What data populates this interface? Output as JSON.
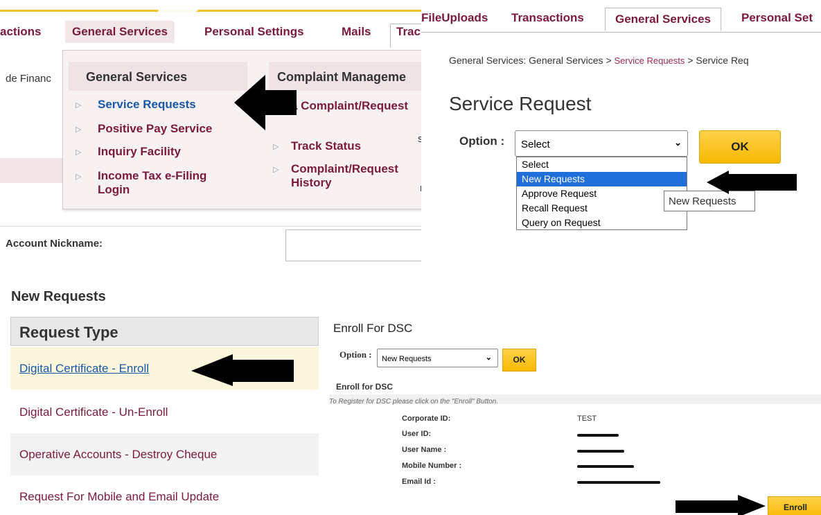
{
  "panel1": {
    "nav": {
      "transactions_partial": "actions",
      "general_services": "General Services",
      "personal_settings": "Personal Settings",
      "mails": "Mails",
      "trac_partial": "Trac"
    },
    "left_cut_text": "de Financ",
    "dropdown": {
      "col1_heading": "General Services",
      "col1_items": [
        "Service Requests",
        "Positive Pay Service",
        "Inquiry Facility",
        "Income Tax e-Filing Login"
      ],
      "col2_heading": "Complaint Manageme",
      "col2_items": [
        "a Complaint/Request",
        "Track Status",
        "Complaint/Request History"
      ]
    },
    "side_cut_1": "st",
    "side_cut_2": "r",
    "account_nickname_label": "Account Nickname:"
  },
  "panel2": {
    "tabs": [
      "FileUploads",
      "Transactions",
      "General Services",
      "Personal Set"
    ],
    "breadcrumb": {
      "part1": "General Services: General Services",
      "sep": ">",
      "link": "Service Requests",
      "part3": "Service Req"
    },
    "title": "Service Request",
    "option_label": "Option :",
    "select_value": "Select",
    "ok_label": "OK",
    "options": [
      "Select",
      "New Requests",
      "Approve Request",
      "Recall Request",
      "Query on Request"
    ],
    "highlighted_option": "New Requests",
    "tooltip": "New Requests"
  },
  "panel3": {
    "section_title": "New Requests",
    "table_header": "Request Type",
    "rows": [
      "Digital Certificate - Enroll",
      "Digital Certificate - Un-Enroll",
      "Operative Accounts - Destroy Cheque",
      "Request For Mobile and Email Update"
    ]
  },
  "panel4": {
    "heading": "Enroll For DSC",
    "option_label": "Option :",
    "select_value": "New Requests",
    "ok_label": "OK",
    "subheading": "Enroll for DSC",
    "note": "To Register for DSC please click on the \"Enroll\" Button.",
    "fields": [
      {
        "label": "Corporate ID:",
        "value": "TEST"
      },
      {
        "label": "User ID:",
        "value": ""
      },
      {
        "label": "User Name :",
        "value": ""
      },
      {
        "label": "Mobile Number :",
        "value": ""
      },
      {
        "label": "Email Id :",
        "value": ""
      }
    ],
    "enroll_label": "Enroll"
  },
  "colors": {
    "brand_maroon": "#7a1a3c",
    "link_blue": "#1a57a8",
    "button_yellow": "#f6b800",
    "select_highlight": "#1e6fd9"
  }
}
